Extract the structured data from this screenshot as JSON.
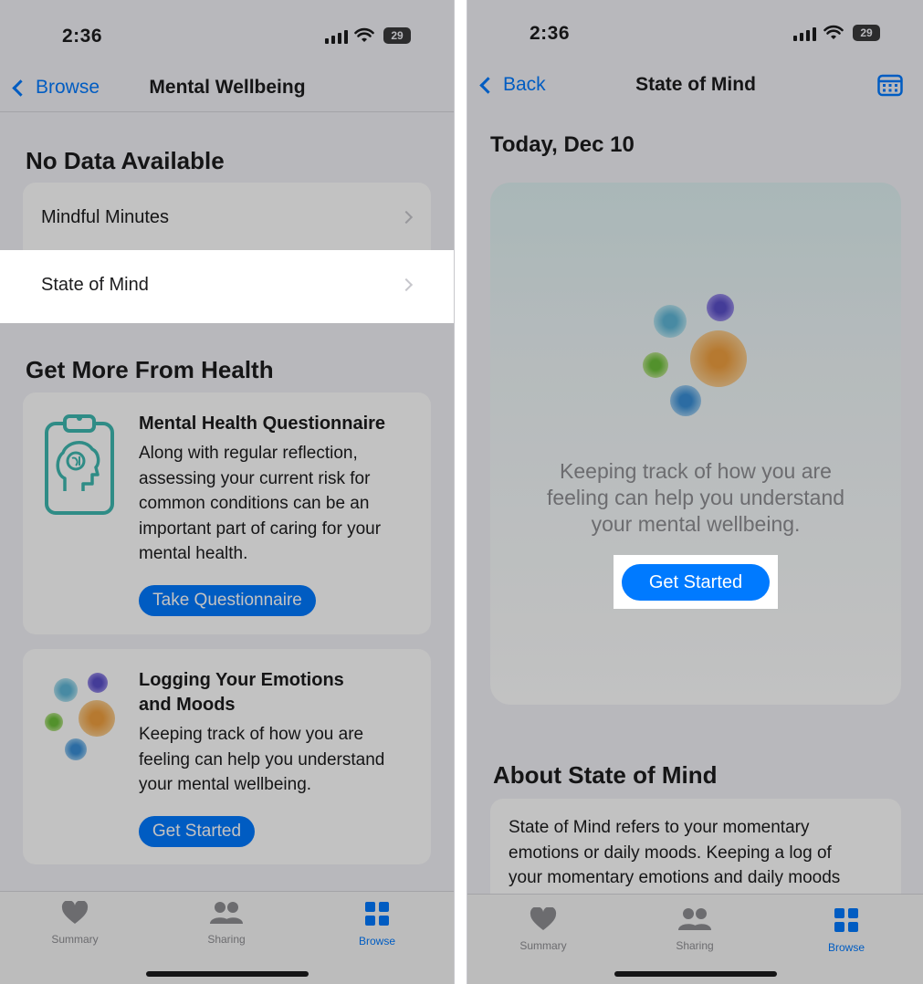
{
  "left": {
    "status": {
      "time": "2:36",
      "battery": "29"
    },
    "nav": {
      "back_label": "Browse",
      "title": "Mental Wellbeing"
    },
    "no_data": {
      "header": "No Data Available",
      "rows": [
        {
          "label": "Mindful Minutes"
        },
        {
          "label": "State of Mind"
        }
      ]
    },
    "more": {
      "header": "Get More From Health",
      "cards": [
        {
          "icon": "brain-clipboard-icon",
          "title": "Mental Health Questionnaire",
          "body": "Along with regular reflection, assessing your current risk for common conditions can be an important part of caring for your mental health.",
          "button": "Take Questionnaire"
        },
        {
          "icon": "emotion-flowers-icon",
          "title_line1": "Logging Your Emotions",
          "title_line2": "and Moods",
          "body": "Keeping track of how you are feeling can help you understand your mental wellbeing.",
          "button": "Get Started"
        }
      ]
    },
    "tabs": [
      {
        "label": "Summary",
        "icon": "heart-icon"
      },
      {
        "label": "Sharing",
        "icon": "people-icon"
      },
      {
        "label": "Browse",
        "icon": "grid-icon",
        "active": true
      }
    ]
  },
  "right": {
    "status": {
      "time": "2:36",
      "battery": "29"
    },
    "nav": {
      "back_label": "Back",
      "title": "State of Mind",
      "action_icon": "calendar-icon"
    },
    "date": "Today, Dec 10",
    "empty_state": {
      "text_line1": "Keeping track of how you are",
      "text_line2": "feeling can help you understand",
      "text_line3": "your mental wellbeing.",
      "button": "Get Started"
    },
    "about": {
      "header": "About State of Mind",
      "body_line1": "State of Mind refers to your momentary",
      "body_line2": "emotions or daily moods. Keeping a log of",
      "body_line3": "your momentary emotions and daily moods"
    },
    "tabs": [
      {
        "label": "Summary",
        "icon": "heart-icon"
      },
      {
        "label": "Sharing",
        "icon": "people-icon"
      },
      {
        "label": "Browse",
        "icon": "grid-icon",
        "active": true
      }
    ]
  },
  "colors": {
    "accent": "#007aff",
    "background": "#f2f2f7",
    "teal_icon": "#3fb9b0",
    "highlight": "#ffffff"
  }
}
